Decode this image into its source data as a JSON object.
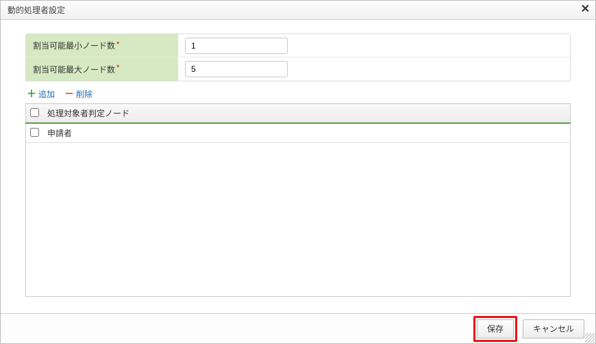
{
  "dialog": {
    "title": "動的処理者設定"
  },
  "form": {
    "min_nodes": {
      "label": "割当可能最小ノード数",
      "value": "1"
    },
    "max_nodes": {
      "label": "割当可能最大ノード数",
      "value": "5"
    }
  },
  "toolbar": {
    "add": "追加",
    "remove": "削除"
  },
  "table": {
    "header": "処理対象者判定ノード",
    "rows": [
      {
        "label": "申請者"
      }
    ]
  },
  "footer": {
    "save": "保存",
    "cancel": "キャンセル"
  }
}
